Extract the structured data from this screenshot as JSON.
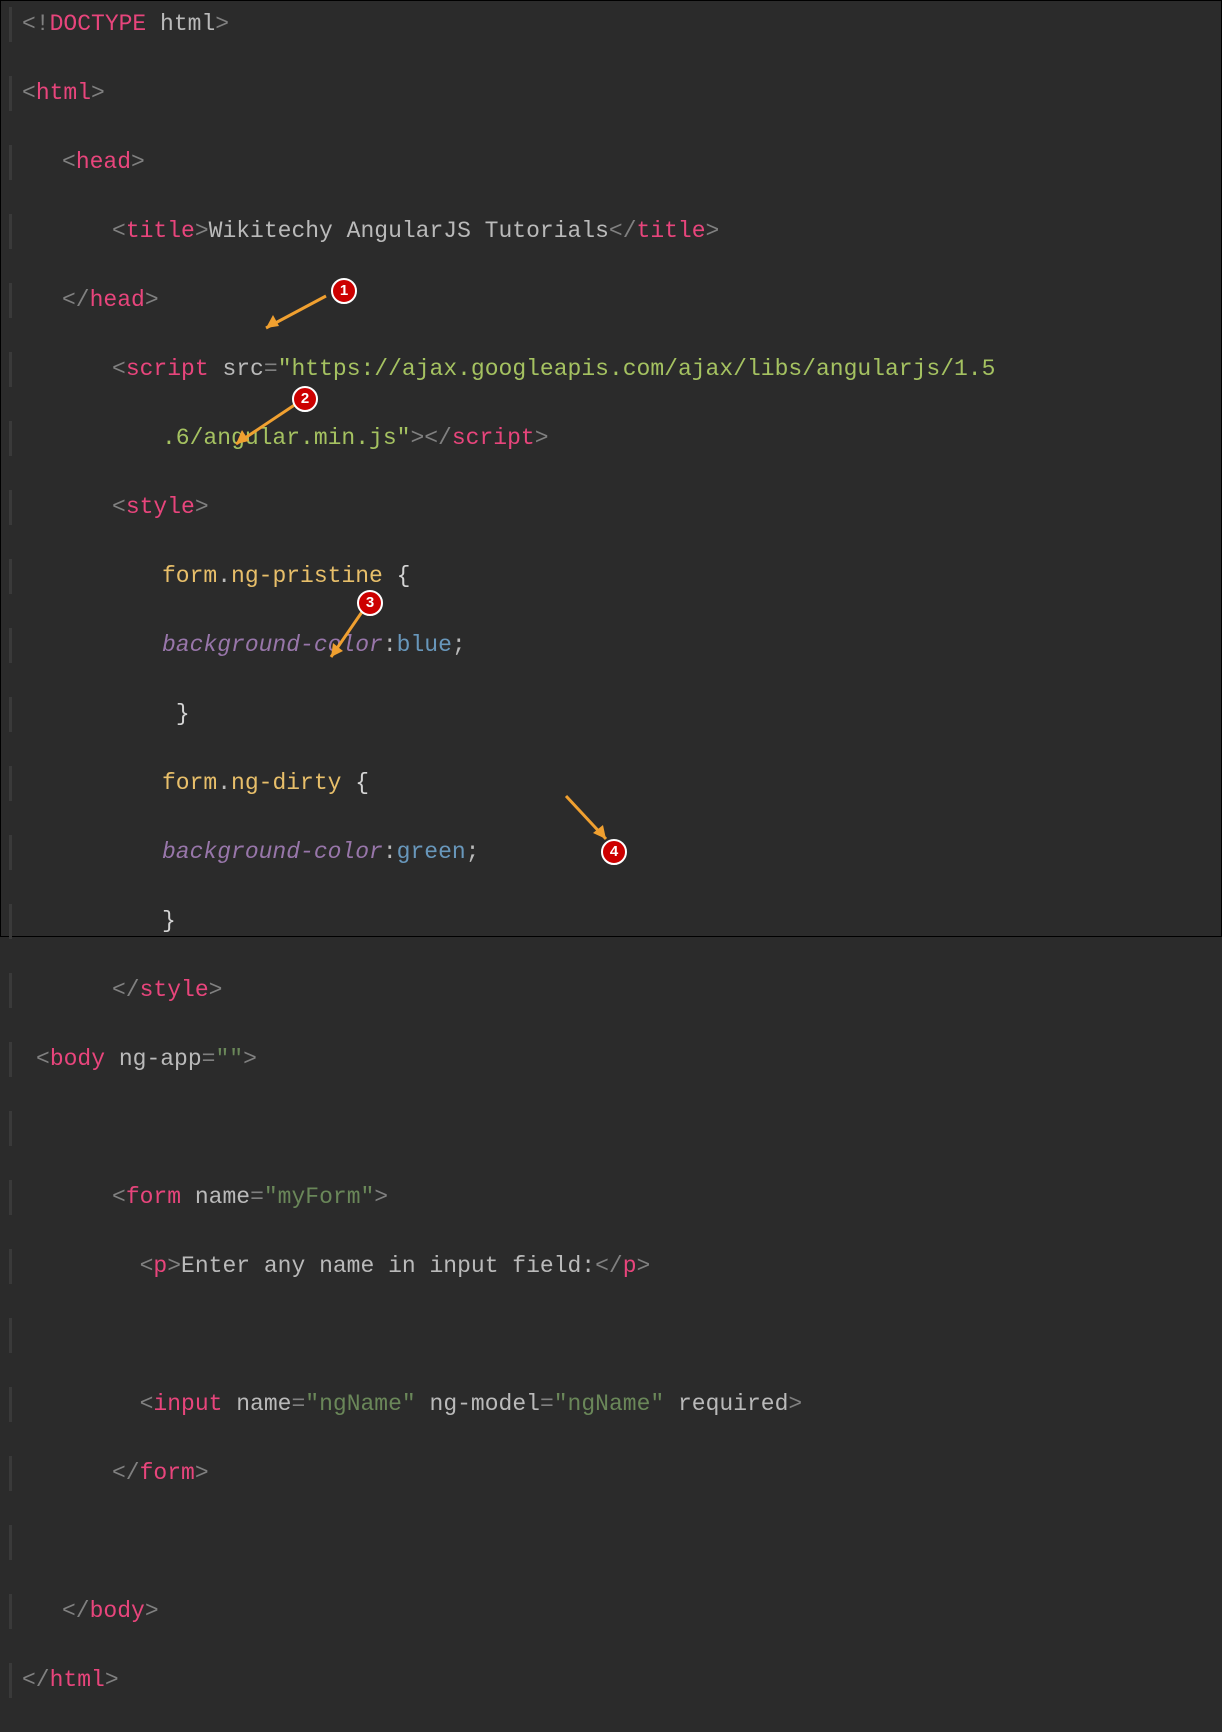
{
  "code": {
    "doctype_open": "<!",
    "doctype_kw": "DOCTYPE",
    "doctype_rest": " html",
    "doctype_close": ">",
    "html_open": "html",
    "head_open": "head",
    "title_tag": "title",
    "title_text": "Wikitechy AngularJS Tutorials",
    "head_close": "head",
    "script_tag": "script",
    "src_attr": "src",
    "src_val_a": "\"https://ajax.googleapis.com/ajax/libs/angularjs/1.5",
    "src_val_b": ".6/angular.min.js\"",
    "style_tag": "style",
    "sel_form": "form",
    "cls_pristine": "ng-pristine",
    "prop_bg": "background-color",
    "val_blue": "blue",
    "cls_dirty": "ng-dirty",
    "val_green": "green",
    "body_tag": "body",
    "ngapp_attr": "ng-app",
    "ngapp_val": "\"\"",
    "form_tag": "form",
    "name_attr": "name",
    "myform_val": "\"myForm\"",
    "p_tag": "p",
    "p_text": "Enter any name in input field:",
    "input_tag": "input",
    "ngname_val": "\"ngName\"",
    "ngmodel_attr": "ng-model",
    "ngmodel_val": "\"ngName\"",
    "required_attr": "required"
  },
  "badges": {
    "b1": "1",
    "b2": "2",
    "b3": "3",
    "b4": "4"
  }
}
